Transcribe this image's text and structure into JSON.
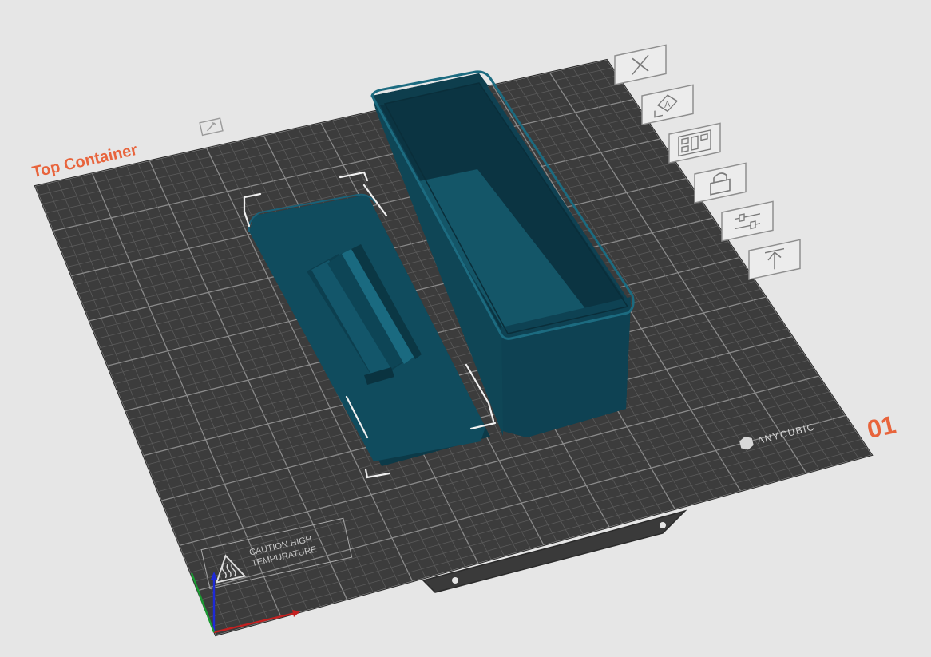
{
  "plate": {
    "name": "Top Container",
    "number": "01",
    "brand": "ANYCUBIC",
    "caution_line1": "CAUTION HIGH",
    "caution_line2": "TEMPURATURE"
  },
  "toolbar": {
    "items": [
      {
        "icon": "close-icon"
      },
      {
        "icon": "auto-orient-icon"
      },
      {
        "icon": "arrange-icon"
      },
      {
        "icon": "lock-icon"
      },
      {
        "icon": "plate-settings-icon"
      },
      {
        "icon": "move-to-top-icon"
      }
    ]
  },
  "colors": {
    "accent": "#e8643c",
    "model": "#0f4a5c",
    "plate": "#3d3d3d",
    "background": "#e6e6e6"
  }
}
